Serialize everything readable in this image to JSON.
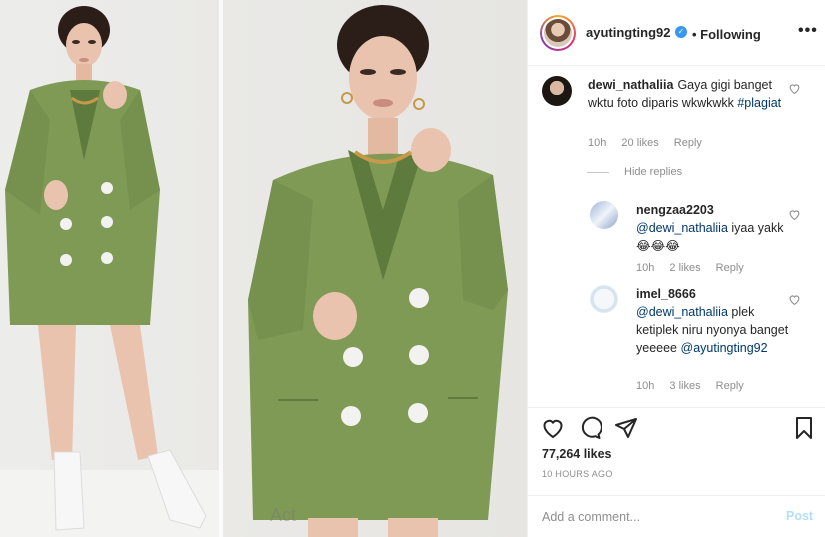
{
  "post": {
    "username": "ayutingting92",
    "verified_mark": "✓",
    "follow_state": "• Following",
    "more_icon": "more-icon"
  },
  "comments": [
    {
      "user": "dewi_nathaliia",
      "text": "Gaya gigi banget wktu foto diparis wkwkwkk",
      "hashtag": "#plagiat",
      "time": "10h",
      "likes": "20 likes",
      "reply": "Reply"
    }
  ],
  "hide_replies": "Hide replies",
  "replies": [
    {
      "user": "nengzaa2203",
      "mention": "@dewi_nathaliia",
      "text": " iyaa yakk 😂😂😂",
      "time": "10h",
      "likes": "2 likes",
      "reply": "Reply"
    },
    {
      "user": "imel_8666",
      "mention": "@dewi_nathaliia",
      "text": " plek ketiplek niru nyonya banget yeeeee",
      "mention2": "@ayutingting92",
      "time": "10h",
      "likes": "3 likes",
      "reply": "Reply"
    }
  ],
  "stats": {
    "likes": "77,264 likes",
    "time_ago": "10 HOURS AGO"
  },
  "composer": {
    "placeholder": "Add a comment...",
    "post_label": "Post"
  },
  "overlay": {
    "watermark": "Act"
  },
  "colors": {
    "jacket": "#7f9a55",
    "accent_link": "#00376b",
    "post_button": "#b2dffc"
  }
}
